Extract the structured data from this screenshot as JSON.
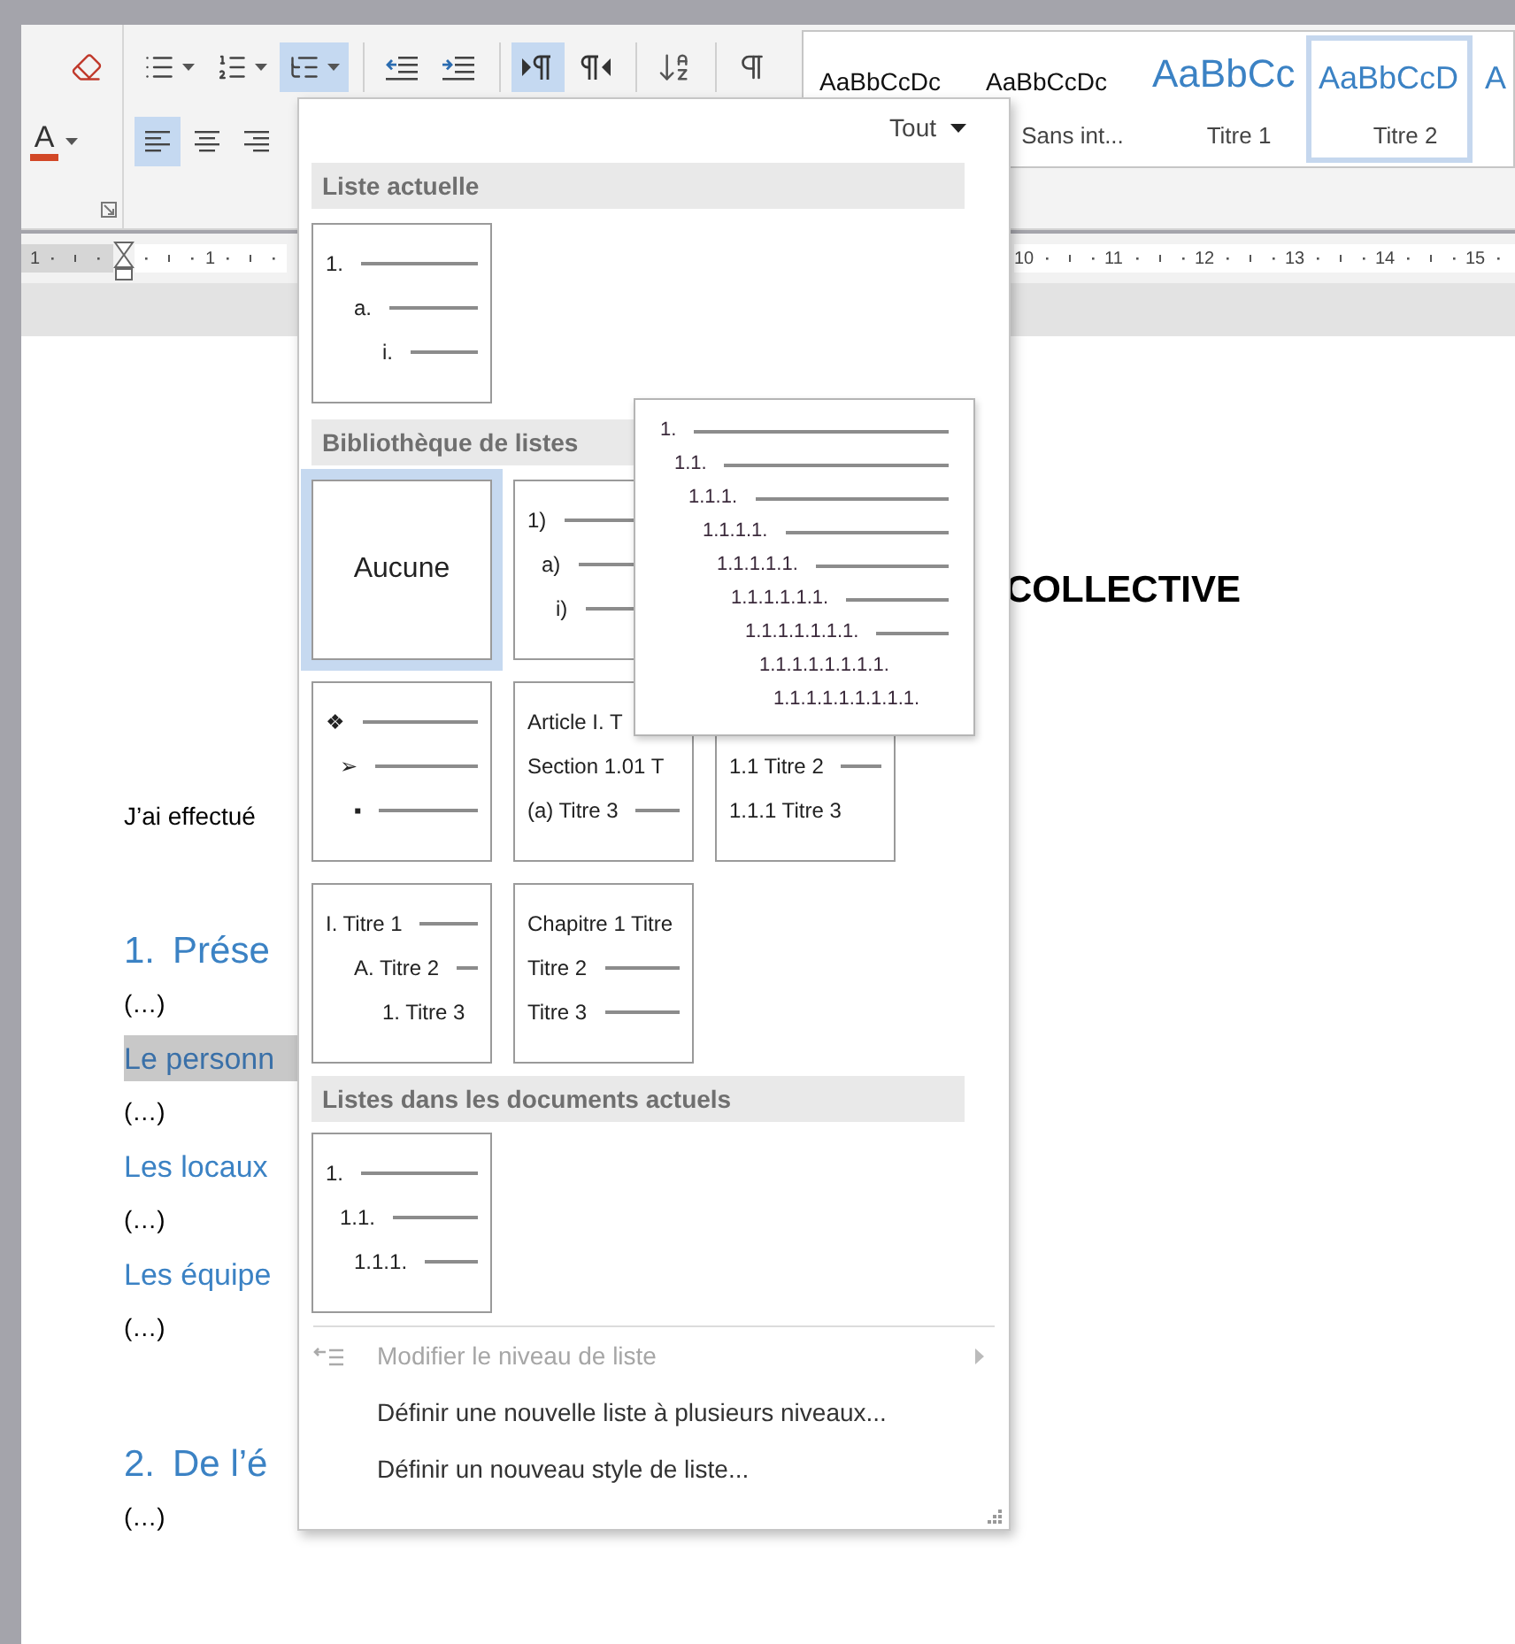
{
  "ribbon": {
    "font_group": {
      "row1": [
        {
          "kind": "clear_formatting",
          "selected": false,
          "menu": false
        }
      ],
      "row2": [
        {
          "kind": "font_color",
          "label": "A",
          "selected": false,
          "menu": true
        }
      ]
    },
    "paragraph_group": {
      "row1": [
        [
          {
            "kind": "bullets",
            "selected": false,
            "menu": true
          },
          {
            "kind": "numbering",
            "selected": false,
            "menu": true
          },
          {
            "kind": "multilevel",
            "selected": true,
            "menu": true
          }
        ],
        [
          {
            "kind": "outdent",
            "selected": false,
            "menu": false
          },
          {
            "kind": "indent",
            "selected": false,
            "menu": false
          }
        ],
        [
          {
            "kind": "ltr",
            "selected": true,
            "menu": false
          },
          {
            "kind": "rtl",
            "selected": false,
            "menu": false
          }
        ],
        [
          {
            "kind": "sort",
            "selected": false,
            "menu": false
          }
        ],
        [
          {
            "kind": "marks",
            "selected": false,
            "menu": false
          }
        ]
      ],
      "row2": [
        {
          "kind": "align_left",
          "selected": true,
          "menu": false
        },
        {
          "kind": "align_center",
          "selected": false,
          "menu": false
        },
        {
          "kind": "align_right",
          "selected": false,
          "menu": false
        }
      ]
    },
    "styles": [
      {
        "sample": "AaBbCcDc",
        "kind": "plain",
        "selected": false
      },
      {
        "sample": "AaBbCcDc",
        "label": "Sans int...",
        "kind": "plain",
        "selected": false
      },
      {
        "sample": "AaBbCc",
        "label": "Titre 1",
        "kind": "heading1",
        "selected": false
      },
      {
        "sample": "AaBbCcD",
        "label": "Titre 2",
        "kind": "heading2",
        "selected": true
      },
      {
        "sample": "A",
        "kind": "heading2",
        "selected": false
      }
    ]
  },
  "ruler": {
    "left_labels": [
      "1",
      "1"
    ],
    "right_labels": [
      "10",
      "11",
      "12",
      "13",
      "14",
      "15"
    ]
  },
  "document": {
    "title": "COLLECTIVE",
    "paragraphs": [
      {
        "kind": "lead",
        "text": "J’ai effectué"
      },
      {
        "kind": "heading1",
        "number": "1.",
        "text": "Prése"
      },
      {
        "kind": "body",
        "text": "(…)"
      },
      {
        "kind": "heading2",
        "text": "Le personn",
        "highlighted": true
      },
      {
        "kind": "body",
        "text": "(…)"
      },
      {
        "kind": "heading2",
        "text": "Les locaux",
        "highlighted": false
      },
      {
        "kind": "body",
        "text": "(…)"
      },
      {
        "kind": "heading2",
        "text": "Les équipe",
        "highlighted": false
      },
      {
        "kind": "body",
        "text": "(…)"
      },
      {
        "kind": "heading1",
        "number": "2.",
        "text": "De l’é"
      },
      {
        "kind": "body",
        "text": "(…)"
      }
    ]
  },
  "menu": {
    "filter": "Tout",
    "current_list": {
      "title": "Liste actuelle",
      "tile": {
        "kind": "outline",
        "selected": false,
        "rows": [
          {
            "text": "1.",
            "dash": true
          },
          {
            "text": "a.",
            "dash": true
          },
          {
            "text": "i.",
            "dash": true
          }
        ]
      }
    },
    "library": {
      "title": "Bibliothèque de listes",
      "rows": [
        {
          "tiles": [
            {
              "kind": "none",
              "label": "Aucune",
              "selected": true
            },
            {
              "kind": "compact",
              "selected": false,
              "rows": [
                {
                  "text": "1)",
                  "dash": true
                },
                {
                  "text": "a)",
                  "dash": true
                },
                {
                  "text": "i)",
                  "dash": true
                }
              ]
            }
          ]
        },
        {
          "tiles": [
            {
              "kind": "compact",
              "selected": false,
              "rows": [
                {
                  "text": "❖",
                  "dash": true
                },
                {
                  "text": "➢",
                  "dash": true
                },
                {
                  "text": "▪",
                  "dash": true
                }
              ]
            },
            {
              "kind": "flat",
              "selected": false,
              "rows": [
                {
                  "text": "Article I. T",
                  "dash": false
                },
                {
                  "text": "Section 1.01 T",
                  "dash": false
                },
                {
                  "text": "(a) Titre 3",
                  "dash": true
                }
              ]
            },
            {
              "kind": "flat",
              "selected": false,
              "rows": [
                {
                  "text": "1.1 Titre 2",
                  "dash": true
                },
                {
                  "text": "1.1.1 Titre 3",
                  "dash": false
                }
              ]
            }
          ]
        },
        {
          "tiles": [
            {
              "kind": "outline",
              "selected": false,
              "rows": [
                {
                  "text": "I. Titre 1",
                  "dash": true
                },
                {
                  "text": "A. Titre 2",
                  "dash": true
                },
                {
                  "text": "1. Titre 3",
                  "dash": false
                }
              ]
            },
            {
              "kind": "flat",
              "selected": false,
              "rows": [
                {
                  "text": "Chapitre 1 Titre",
                  "dash": false
                },
                {
                  "text": "Titre 2",
                  "dash": true
                },
                {
                  "text": "Titre 3",
                  "dash": true
                }
              ]
            }
          ]
        }
      ]
    },
    "document_lists": {
      "title": "Listes dans les documents actuels",
      "tile": {
        "kind": "compact",
        "selected": false,
        "rows": [
          {
            "text": "1.",
            "dash": true
          },
          {
            "text": "1.1.",
            "dash": true
          },
          {
            "text": "1.1.1.",
            "dash": true
          }
        ]
      }
    },
    "preview": {
      "rows": [
        {
          "text": "1.",
          "dash": true
        },
        {
          "text": "1.1.",
          "dash": true
        },
        {
          "text": "1.1.1.",
          "dash": true
        },
        {
          "text": "1.1.1.1.",
          "dash": true
        },
        {
          "text": "1.1.1.1.1.",
          "dash": true
        },
        {
          "text": "1.1.1.1.1.1.",
          "dash": true
        },
        {
          "text": "1.1.1.1.1.1.1.",
          "dash": true
        },
        {
          "text": "1.1.1.1.1.1.1.1.",
          "dash": false
        },
        {
          "text": "1.1.1.1.1.1.1.1.1.",
          "dash": false
        }
      ]
    },
    "actions": [
      {
        "kind": "submenu",
        "label": "Modifier le niveau de liste",
        "disabled": true
      },
      {
        "kind": "command",
        "label": "Définir une nouvelle liste à plusieurs niveaux...",
        "disabled": false
      },
      {
        "kind": "command",
        "label": "Définir un nouveau style de liste...",
        "disabled": false
      }
    ]
  }
}
